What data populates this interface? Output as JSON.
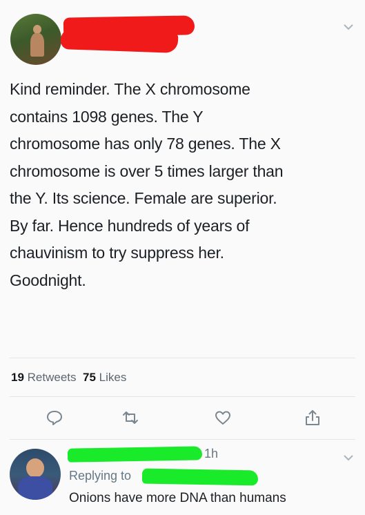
{
  "tweet": {
    "text": "Kind reminder. The X chromosome\ncontains 1098 genes. The Y\nchromosome has only 78 genes. The X\nchromosome is over 5 times larger than\nthe Y. Its science. Female are superior.\nBy far. Hence hundreds of years of\nchauvinism to try suppress her.\nGoodnight.",
    "retweet_count": "19",
    "retweet_label": "Retweets",
    "like_count": "75",
    "like_label": "Likes"
  },
  "actions": {
    "reply_icon": "reply-icon",
    "retweet_icon": "retweet-icon",
    "like_icon": "heart-icon",
    "share_icon": "share-icon"
  },
  "reply": {
    "time": "1h",
    "replying_to": "Replying to",
    "text": "Onions have more DNA than humans"
  },
  "colors": {
    "redaction_red": "#f11a1a",
    "redaction_green": "#19ea2a",
    "muted": "#657786"
  }
}
